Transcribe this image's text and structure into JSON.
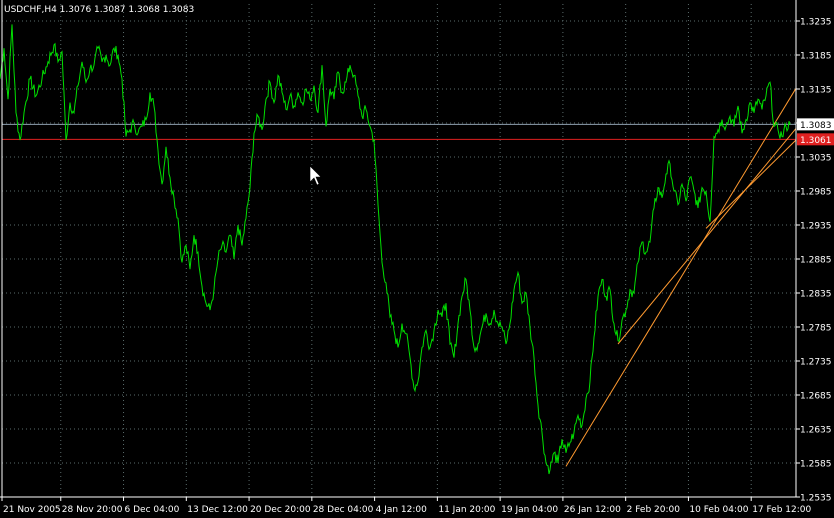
{
  "colors": {
    "background": "#000000",
    "grid": "#5a6b6b",
    "price_line": "#00e000",
    "axis": "#ffffff",
    "bid_line": "#8fa0b0",
    "ask_line": "#e02020",
    "trendline": "#ff9a30"
  },
  "chart_data": {
    "type": "line",
    "title": "USDCHF,H4  1.3076 1.3087 1.3068 1.3083",
    "ylim": [
      1.2535,
      1.326
    ],
    "y_ticks": [
      "1.3235",
      "1.3185",
      "1.3135",
      "1.3085",
      "1.3035",
      "1.2985",
      "1.2935",
      "1.2885",
      "1.2835",
      "1.2785",
      "1.2735",
      "1.2685",
      "1.2635",
      "1.2585",
      "1.2535"
    ],
    "x_ticks": [
      "21 Nov 2005",
      "28 Nov 20:00",
      "6 Dec 04:00",
      "13 Dec 12:00",
      "20 Dec 20:00",
      "28 Dec 04:00",
      "4 Jan 12:00",
      "11 Jan 20:00",
      "19 Jan 04:00",
      "26 Jan 12:00",
      "2 Feb 20:00",
      "10 Feb 04:00",
      "17 Feb 12:00"
    ],
    "grid": true,
    "current_price": "1.3083",
    "price_line_level": "1.3061",
    "series": [
      {
        "anchors": [
          [
            0,
            1.315
          ],
          [
            4,
            1.3195
          ],
          [
            8,
            1.312
          ],
          [
            12,
            1.323
          ],
          [
            16,
            1.31
          ],
          [
            20,
            1.306
          ],
          [
            24,
            1.31
          ],
          [
            30,
            1.315
          ],
          [
            36,
            1.3125
          ],
          [
            42,
            1.315
          ],
          [
            48,
            1.3175
          ],
          [
            54,
            1.32
          ],
          [
            58,
            1.3175
          ],
          [
            62,
            1.319
          ],
          [
            66,
            1.306
          ],
          [
            70,
            1.3115
          ],
          [
            74,
            1.31
          ],
          [
            78,
            1.314
          ],
          [
            82,
            1.3175
          ],
          [
            86,
            1.3145
          ],
          [
            90,
            1.3165
          ],
          [
            94,
            1.317
          ],
          [
            98,
            1.3195
          ],
          [
            102,
            1.3175
          ],
          [
            106,
            1.3185
          ],
          [
            110,
            1.317
          ],
          [
            114,
            1.3195
          ],
          [
            118,
            1.3185
          ],
          [
            122,
            1.315
          ],
          [
            126,
            1.3065
          ],
          [
            130,
            1.3075
          ],
          [
            134,
            1.3085
          ],
          [
            138,
            1.307
          ],
          [
            142,
            1.308
          ],
          [
            146,
            1.309
          ],
          [
            150,
            1.313
          ],
          [
            154,
            1.311
          ],
          [
            158,
            1.3045
          ],
          [
            162,
            1.2995
          ],
          [
            166,
            1.305
          ],
          [
            170,
            1.3005
          ],
          [
            174,
            1.2975
          ],
          [
            178,
            1.2945
          ],
          [
            182,
            1.288
          ],
          [
            186,
            1.2905
          ],
          [
            190,
            1.287
          ],
          [
            194,
            1.292
          ],
          [
            198,
            1.2895
          ],
          [
            202,
            1.2845
          ],
          [
            206,
            1.282
          ],
          [
            210,
            1.281
          ],
          [
            214,
            1.284
          ],
          [
            218,
            1.2885
          ],
          [
            222,
            1.2905
          ],
          [
            226,
            1.2895
          ],
          [
            230,
            1.292
          ],
          [
            234,
            1.2885
          ],
          [
            238,
            1.2935
          ],
          [
            242,
            1.2905
          ],
          [
            246,
            1.2945
          ],
          [
            250,
            1.299
          ],
          [
            254,
            1.307
          ],
          [
            258,
            1.3095
          ],
          [
            262,
            1.3075
          ],
          [
            266,
            1.312
          ],
          [
            270,
            1.3145
          ],
          [
            274,
            1.3115
          ],
          [
            278,
            1.3155
          ],
          [
            282,
            1.313
          ],
          [
            286,
            1.3105
          ],
          [
            290,
            1.3125
          ],
          [
            294,
            1.311
          ],
          [
            298,
            1.313
          ],
          [
            302,
            1.3115
          ],
          [
            306,
            1.3135
          ],
          [
            310,
            1.312
          ],
          [
            314,
            1.314
          ],
          [
            318,
            1.31
          ],
          [
            322,
            1.317
          ],
          [
            326,
            1.308
          ],
          [
            330,
            1.3135
          ],
          [
            334,
            1.312
          ],
          [
            338,
            1.316
          ],
          [
            342,
            1.313
          ],
          [
            346,
            1.3145
          ],
          [
            350,
            1.317
          ],
          [
            354,
            1.3155
          ],
          [
            358,
            1.3125
          ],
          [
            362,
            1.3095
          ],
          [
            366,
            1.3105
          ],
          [
            370,
            1.308
          ],
          [
            374,
            1.306
          ],
          [
            378,
            1.2965
          ],
          [
            382,
            1.288
          ],
          [
            386,
            1.285
          ],
          [
            390,
            1.28
          ],
          [
            394,
            1.278
          ],
          [
            398,
            1.2755
          ],
          [
            402,
            1.279
          ],
          [
            406,
            1.2775
          ],
          [
            410,
            1.274
          ],
          [
            414,
            1.2695
          ],
          [
            418,
            1.2705
          ],
          [
            422,
            1.2755
          ],
          [
            426,
            1.278
          ],
          [
            430,
            1.2755
          ],
          [
            434,
            1.278
          ],
          [
            438,
            1.281
          ],
          [
            442,
            1.28
          ],
          [
            446,
            1.282
          ],
          [
            450,
            1.276
          ],
          [
            454,
            1.274
          ],
          [
            458,
            1.279
          ],
          [
            462,
            1.283
          ],
          [
            466,
            1.2855
          ],
          [
            470,
            1.281
          ],
          [
            474,
            1.2755
          ],
          [
            478,
            1.276
          ],
          [
            482,
            1.2785
          ],
          [
            486,
            1.2805
          ],
          [
            490,
            1.279
          ],
          [
            494,
            1.281
          ],
          [
            498,
            1.279
          ],
          [
            502,
            1.2785
          ],
          [
            506,
            1.276
          ],
          [
            510,
            1.279
          ],
          [
            514,
            1.284
          ],
          [
            518,
            1.2865
          ],
          [
            522,
            1.282
          ],
          [
            526,
            1.2835
          ],
          [
            530,
            1.2785
          ],
          [
            534,
            1.274
          ],
          [
            538,
            1.267
          ],
          [
            542,
            1.263
          ],
          [
            546,
            1.2585
          ],
          [
            550,
            1.2575
          ],
          [
            554,
            1.26
          ],
          [
            558,
            1.2585
          ],
          [
            562,
            1.262
          ],
          [
            566,
            1.26
          ],
          [
            570,
            1.2615
          ],
          [
            574,
            1.263
          ],
          [
            578,
            1.2655
          ],
          [
            582,
            1.264
          ],
          [
            586,
            1.268
          ],
          [
            590,
            1.2705
          ],
          [
            594,
            1.277
          ],
          [
            598,
            1.283
          ],
          [
            602,
            1.2855
          ],
          [
            606,
            1.283
          ],
          [
            610,
            1.284
          ],
          [
            614,
            1.279
          ],
          [
            618,
            1.2765
          ],
          [
            622,
            1.2795
          ],
          [
            626,
            1.281
          ],
          [
            630,
            1.284
          ],
          [
            634,
            1.2835
          ],
          [
            638,
            1.288
          ],
          [
            642,
            1.291
          ],
          [
            646,
            1.2895
          ],
          [
            650,
            1.291
          ],
          [
            654,
            1.296
          ],
          [
            658,
            1.299
          ],
          [
            662,
            1.2975
          ],
          [
            666,
            1.301
          ],
          [
            670,
            1.3025
          ],
          [
            674,
            1.2985
          ],
          [
            678,
            1.2965
          ],
          [
            682,
            1.2995
          ],
          [
            686,
            1.297
          ],
          [
            690,
            1.3005
          ],
          [
            694,
            1.2985
          ],
          [
            698,
            1.296
          ],
          [
            702,
            1.299
          ],
          [
            706,
            1.2985
          ],
          [
            710,
            1.294
          ],
          [
            714,
            1.3065
          ],
          [
            718,
            1.3075
          ],
          [
            722,
            1.309
          ],
          [
            726,
            1.308
          ],
          [
            730,
            1.3095
          ],
          [
            734,
            1.308
          ],
          [
            738,
            1.311
          ],
          [
            742,
            1.307
          ],
          [
            746,
            1.309
          ],
          [
            750,
            1.3115
          ],
          [
            754,
            1.31
          ],
          [
            758,
            1.312
          ],
          [
            762,
            1.3105
          ],
          [
            766,
            1.3125
          ],
          [
            770,
            1.3145
          ],
          [
            774,
            1.308
          ],
          [
            778,
            1.3075
          ],
          [
            782,
            1.3065
          ],
          [
            786,
            1.308
          ],
          [
            790,
            1.3083
          ]
        ]
      }
    ],
    "trendlines": [
      {
        "from": [
          566,
          1.258
        ],
        "to": [
          796,
          1.3136
        ]
      },
      {
        "from": [
          618,
          1.276
        ],
        "to": [
          796,
          1.3077
        ]
      },
      {
        "from": [
          706,
          1.293
        ],
        "to": [
          796,
          1.306
        ]
      }
    ]
  }
}
